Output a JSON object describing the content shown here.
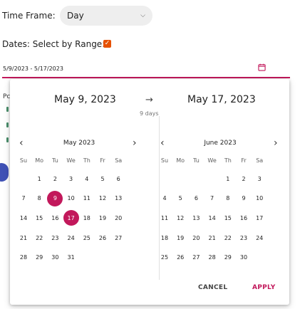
{
  "filters": {
    "time_frame_label": "Time Frame:",
    "time_frame_value": "Day",
    "range_label": "Dates: Select by Range:",
    "date_range_value": "5/9/2023 - 5/17/2023"
  },
  "background": {
    "partial_text": "Pc"
  },
  "picker": {
    "start_date": "May 9, 2023",
    "end_date": "May 17, 2023",
    "arrow": "→",
    "days_count": "9 days",
    "weekdays": [
      "Su",
      "Mo",
      "Tu",
      "We",
      "Th",
      "Fr",
      "Sa"
    ],
    "left_calendar": {
      "title": "May 2023",
      "prev": "‹",
      "next": "›",
      "rows": [
        [
          "",
          "1",
          "2",
          "3",
          "4",
          "5",
          "6"
        ],
        [
          "7",
          "8",
          "9",
          "10",
          "11",
          "12",
          "13"
        ],
        [
          "14",
          "15",
          "16",
          "17",
          "18",
          "19",
          "20"
        ],
        [
          "21",
          "22",
          "23",
          "24",
          "25",
          "26",
          "27"
        ],
        [
          "28",
          "29",
          "30",
          "31",
          "",
          "",
          ""
        ]
      ],
      "selected": [
        "9",
        "17"
      ]
    },
    "right_calendar": {
      "title": "June 2023",
      "prev": "‹",
      "next": "›",
      "rows": [
        [
          "",
          "",
          "",
          "",
          "1",
          "2",
          "3"
        ],
        [
          "4",
          "5",
          "6",
          "7",
          "8",
          "9",
          "10"
        ],
        [
          "11",
          "12",
          "13",
          "14",
          "15",
          "16",
          "17"
        ],
        [
          "18",
          "19",
          "20",
          "21",
          "22",
          "23",
          "24"
        ],
        [
          "25",
          "26",
          "27",
          "28",
          "29",
          "30",
          ""
        ]
      ],
      "selected": []
    },
    "cancel_label": "CANCEL",
    "apply_label": "APPLY"
  },
  "colors": {
    "accent": "#c2185b",
    "checkbox": "#e65100",
    "select_bg": "#eeeeee"
  }
}
